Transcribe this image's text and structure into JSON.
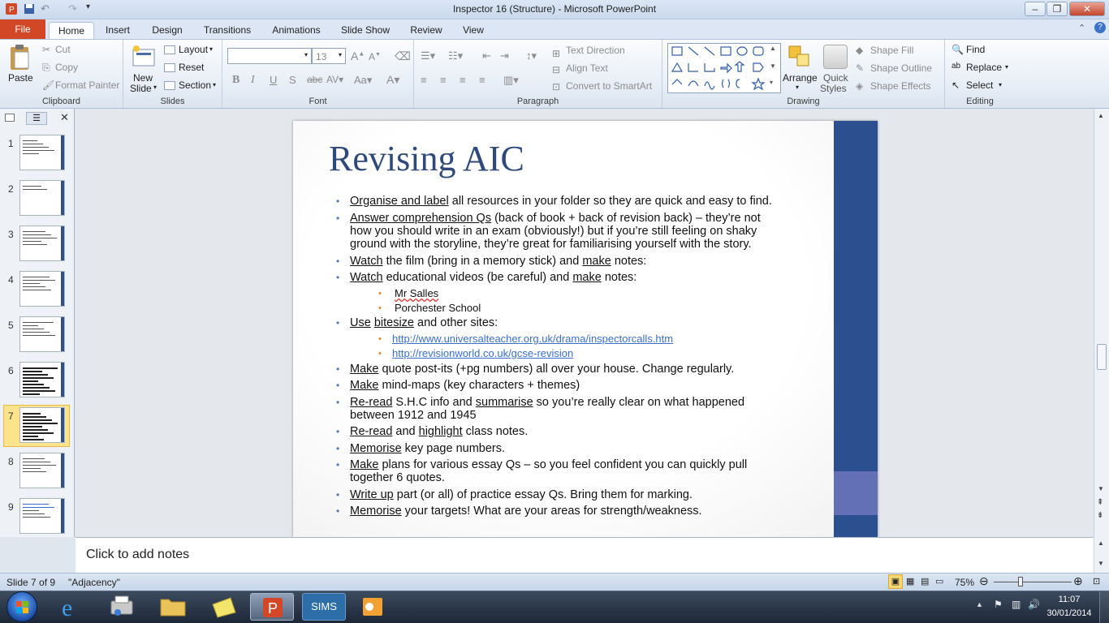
{
  "window": {
    "title": "Inspector 16 (Structure)  -  Microsoft PowerPoint",
    "minimize": "–",
    "maximize": "❐",
    "close": "✕"
  },
  "tabs": [
    "File",
    "Home",
    "Insert",
    "Design",
    "Transitions",
    "Animations",
    "Slide Show",
    "Review",
    "View"
  ],
  "ribbon": {
    "clipboard": {
      "paste": "Paste",
      "cut": "Cut",
      "copy": "Copy",
      "format_painter": "Format Painter",
      "label": "Clipboard"
    },
    "slides": {
      "new_slide_1": "New",
      "new_slide_2": "Slide",
      "layout": "Layout",
      "reset": "Reset",
      "section": "Section",
      "label": "Slides"
    },
    "font": {
      "font_name": "",
      "font_size": "13",
      "label": "Font"
    },
    "paragraph": {
      "text_direction": "Text Direction",
      "align_text": "Align Text",
      "convert_smartart": "Convert to SmartArt",
      "label": "Paragraph"
    },
    "drawing": {
      "arrange": "Arrange",
      "quick_styles_1": "Quick",
      "quick_styles_2": "Styles",
      "shape_fill": "Shape Fill",
      "shape_outline": "Shape Outline",
      "shape_effects": "Shape Effects",
      "label": "Drawing"
    },
    "editing": {
      "find": "Find",
      "replace": "Replace",
      "select": "Select",
      "label": "Editing"
    }
  },
  "slides_panel": {
    "numbers": [
      "1",
      "2",
      "3",
      "4",
      "5",
      "6",
      "7",
      "8",
      "9"
    ],
    "selected": "7"
  },
  "slide": {
    "title": "Revising AIC",
    "bullets": {
      "b1_u": "Organise and label",
      "b1_t": " all resources in your folder so they are quick and easy to find.",
      "b2_u": "Answer comprehension Qs",
      "b2_t": " (back of book + back of revision back) – they’re not",
      "b2_l2": "how you should write in an exam (obviously!) but if you’re still feeling on shaky",
      "b2_l3": "ground with the storyline, they’re great for familiarising yourself with the story.",
      "b3_u": "Watch",
      "b3_t1": " the film (bring in a memory stick) and ",
      "b3_u2": "make",
      "b3_t2": " notes:",
      "b4_u": "Watch",
      "b4_t1": " educational videos (be careful) and ",
      "b4_u2": "make",
      "b4_t2": " notes:",
      "s1": "Mr Salles",
      "s2": "Porchester School",
      "b5_u": "Use",
      "b5_t1": " ",
      "b5_u2": "bitesize",
      "b5_t2": " and other sites:",
      "link1": "http://www.universalteacher.org.uk/drama/inspectorcalls.htm",
      "link2": "http://revisionworld.co.uk/gcse-revision",
      "b6_u": "Make",
      "b6_t": " quote post-its (+pg numbers) all over your house.  Change regularly.",
      "b7_u": "Make",
      "b7_t": " mind-maps (key characters + themes)",
      "b8_u": "Re-read",
      "b8_t1": " S.H.C info and ",
      "b8_u2": "summarise",
      "b8_t2": " so you’re really clear on what happened",
      "b8_l2": "between  1912 and 1945",
      "b9_u": "Re-read",
      "b9_t1": "  and ",
      "b9_u2": "highlight",
      "b9_t2": " class notes.",
      "b10_u": "Memorise",
      "b10_t": " key  page numbers.",
      "b11_u": "Make",
      "b11_t": " plans for various essay Qs – so you feel  confident you can quickly pull",
      "b11_l2": "together 6 quotes.",
      "b12_u": "Write up",
      "b12_t": " part (or all) of practice essay Qs.  Bring them for marking.",
      "b13_u": "Memorise",
      "b13_t": " your targets!  What are your areas for strength/weakness."
    }
  },
  "notes": {
    "placeholder": "Click to add notes"
  },
  "status": {
    "slide_of": "Slide 7 of 9",
    "theme": "\"Adjacency\"",
    "zoom": "75%"
  },
  "taskbar": {
    "sims": "SIMS",
    "time": "11:07",
    "date": "30/01/2014"
  },
  "colors": {
    "file_tab": "#d24726",
    "slide_bar": "#2c4f8f",
    "slide_box": "#6470b5",
    "title": "#2d4a7a",
    "link": "#3a6fc9"
  }
}
